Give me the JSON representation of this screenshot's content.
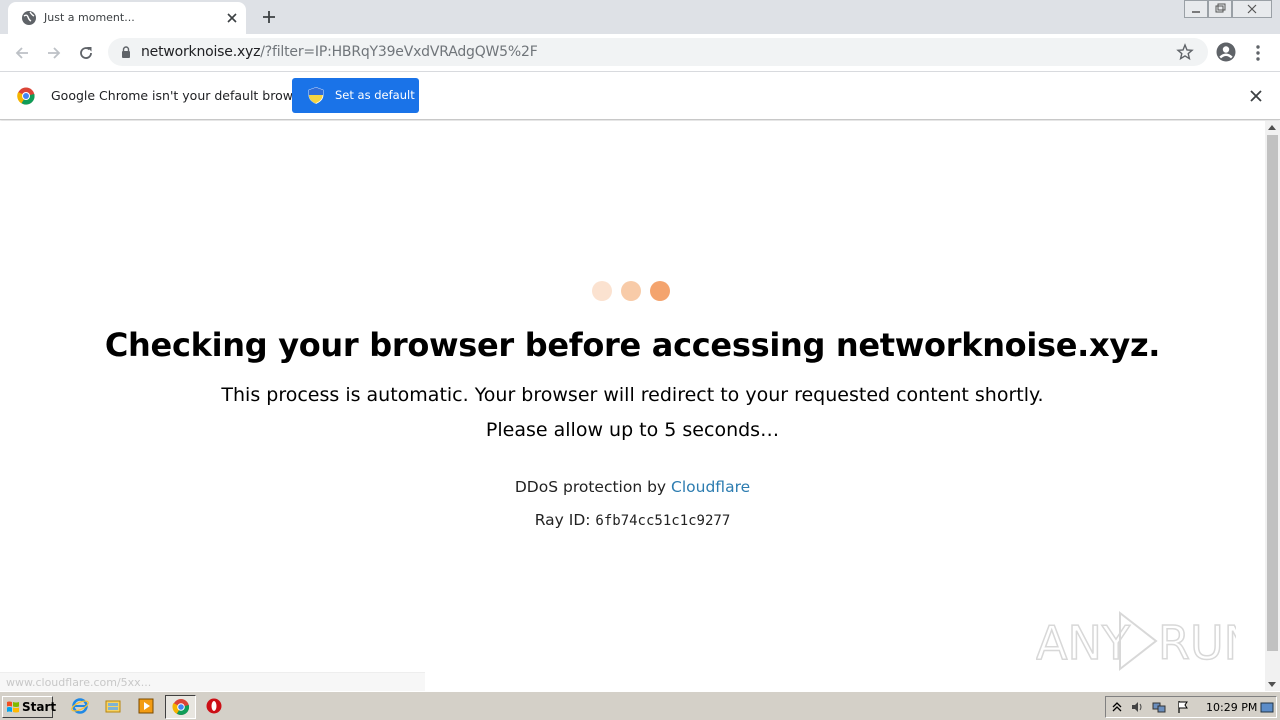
{
  "browser": {
    "tab": {
      "title": "Just a moment...",
      "favicon": "globe-icon"
    },
    "address": {
      "host": "networknoise.xyz",
      "path": "/?filter=IP:HBRqY39eVxdVRAdgQW5%2F"
    },
    "infobar": {
      "message": "Google Chrome isn't your default browser",
      "button_label": "Set as default"
    }
  },
  "page": {
    "loading_dot_colors": [
      "#fbe2d0",
      "#f8cba8",
      "#f4a46e"
    ],
    "heading": "Checking your browser before accessing networknoise.xyz.",
    "line1": "This process is automatic. Your browser will redirect to your requested content shortly.",
    "line2": "Please allow up to 5 seconds…",
    "ddos_prefix": "DDoS protection by ",
    "ddos_link": "Cloudflare",
    "ray_label": "Ray ID: ",
    "ray_id": "6fb74cc51c1c9277",
    "status_url": "www.cloudflare.com/5xx..."
  },
  "watermark": {
    "text": "ANY RUN"
  },
  "taskbar": {
    "start_label": "Start",
    "pinned": [
      "ie-icon",
      "explorer-icon",
      "media-player-icon",
      "chrome-icon",
      "opera-icon"
    ],
    "tray_icons": [
      "up-arrow-icon",
      "volume-icon",
      "network-icon",
      "flag-icon"
    ],
    "clock": "10:29 PM"
  },
  "colors": {
    "accent": "#1a73e8",
    "link": "#2c7cb0"
  }
}
